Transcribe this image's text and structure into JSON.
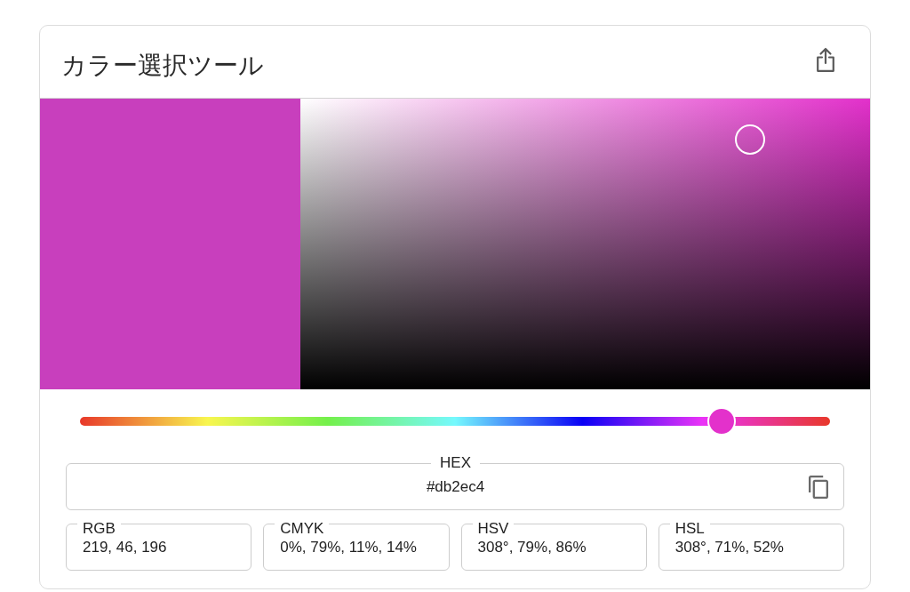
{
  "title": "カラー選択ツール",
  "preview": {
    "color": "#c83fbd"
  },
  "picker": {
    "saturation": {
      "level": 0.79
    },
    "brightness": {
      "level": 0.86
    }
  },
  "hue_slider": {
    "level": 0.856
  },
  "hex_field": {
    "label": "HEX",
    "value": "#db2ec4"
  },
  "format_fields": [
    {
      "label": "RGB",
      "value": "219, 46, 196"
    },
    {
      "label": "CMYK",
      "value": "0%, 79%, 11%, 14%"
    },
    {
      "label": "HSV",
      "value": "308°, 79%, 86%"
    },
    {
      "label": "HSL",
      "value": "308°, 71%, 52%"
    }
  ]
}
